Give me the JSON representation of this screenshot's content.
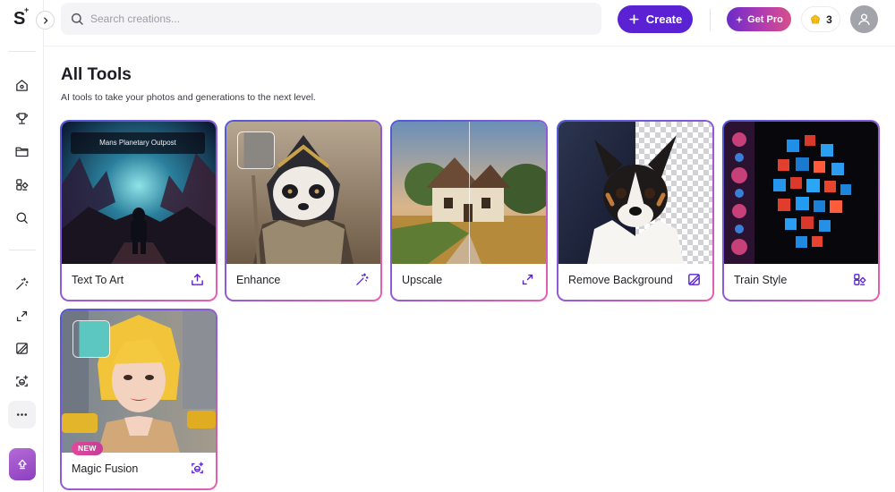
{
  "app": {
    "logo": "S"
  },
  "search": {
    "placeholder": "Search creations..."
  },
  "header": {
    "create_label": "Create",
    "get_pro_label": "Get Pro",
    "credits": "3"
  },
  "page": {
    "title": "All Tools",
    "subtitle": "AI tools to take your photos and generations to the next level."
  },
  "tools": [
    {
      "label": "Text To Art",
      "icon": "upload-tray-icon",
      "banner": "Mans Planetary Outpost"
    },
    {
      "label": "Enhance",
      "icon": "magic-wand-icon"
    },
    {
      "label": "Upscale",
      "icon": "expand-arrow-icon"
    },
    {
      "label": "Remove Background",
      "icon": "remove-background-icon"
    },
    {
      "label": "Train Style",
      "icon": "train-style-icon"
    },
    {
      "label": "Magic Fusion",
      "icon": "face-scan-icon",
      "badge": "NEW"
    }
  ],
  "colors": {
    "primary": "#5a22d3",
    "card_border_start": "#4f59d6",
    "card_border_end": "#ec5fae",
    "badge_new": "#e2489c"
  }
}
